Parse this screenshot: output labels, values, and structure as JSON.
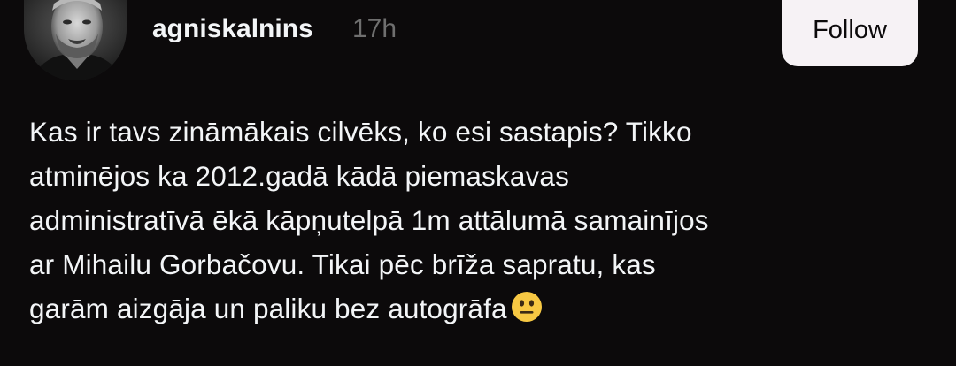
{
  "post": {
    "username": "agniskalnins",
    "timestamp": "17h",
    "follow_label": "Follow",
    "body_lines": [
      "Kas ir tavs zināmākais cilvēks, ko esi sastapis? Tikko",
      "atminējos ka 2012.gadā kādā piemaskavas",
      "administratīvā ēkā kāpņutelpā 1m attālumā samainījos",
      "ar Mihailu Gorbačovu. Tikai pēc brīža sapratu, kas",
      "garām aizgāja un paliku bez autogrāfa"
    ],
    "emoji": "neutral-face-icon"
  },
  "colors": {
    "background": "#0c0a0b",
    "text_primary": "#f3f5f7",
    "text_secondary": "#6f6f6f",
    "button_bg": "#f6f2f5",
    "emoji_yellow": "#f7c843"
  }
}
